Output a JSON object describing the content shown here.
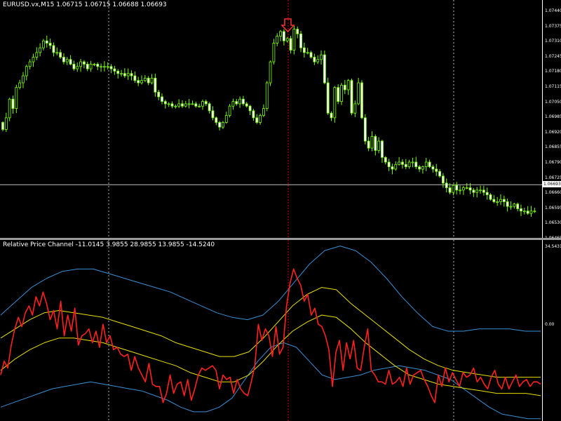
{
  "main_chart": {
    "title": "EURUSD.vx,M15  1.06715 1.06715 1.06688 1.06693",
    "price_ticks": [
      "1.07440",
      "1.07375",
      "1.07310",
      "1.07245",
      "1.07180",
      "1.07115",
      "1.07050",
      "1.06985",
      "1.06920",
      "1.06855",
      "1.06790",
      "1.06725",
      "1.06660",
      "1.06595",
      "1.06530",
      "1.06465"
    ],
    "current_price": "1.06693",
    "arrow_icon": "down-arrow-icon",
    "colors": {
      "background": "#000000",
      "candle": "#7CFC00",
      "bear_body": "#FFFFFF",
      "grid": "#FFFFFF",
      "signal_line": "#FF0000",
      "arrow": "#FF3030",
      "price_line": "#C0C0C0"
    }
  },
  "indicator": {
    "title": "Relative Price Channel -11.0145 3.9855 28.9855 13.9855 -14.5240",
    "ticks": [
      "34.5431",
      "0.00"
    ],
    "colors": {
      "outer_band": "#3A8FD4",
      "inner_band": "#E8E000",
      "value_line": "#FF2020"
    }
  },
  "chart_data": [
    {
      "type": "candlestick",
      "title": "EURUSD.vx,M15",
      "ylim": [
        1.0645,
        1.0746
      ],
      "close": [
        1.0693,
        1.0698,
        1.0706,
        1.0702,
        1.0711,
        1.0713,
        1.0716,
        1.072,
        1.0722,
        1.0724,
        1.0726,
        1.0728,
        1.0731,
        1.073,
        1.0729,
        1.0726,
        1.0726,
        1.0724,
        1.0722,
        1.0723,
        1.0721,
        1.0719,
        1.072,
        1.0722,
        1.0721,
        1.0719,
        1.0721,
        1.0721,
        1.072,
        1.072,
        1.072,
        1.072,
        1.0719,
        1.0718,
        1.0717,
        1.0717,
        1.0716,
        1.0717,
        1.0716,
        1.0714,
        1.0713,
        1.0714,
        1.0715,
        1.0713,
        1.0715,
        1.0709,
        1.0707,
        1.0705,
        1.0704,
        1.0704,
        1.0703,
        1.0703,
        1.0704,
        1.0703,
        1.0704,
        1.0704,
        1.0704,
        1.0703,
        1.0703,
        1.0705,
        1.0704,
        1.0701,
        1.0698,
        1.0696,
        1.0694,
        1.0696,
        1.0699,
        1.0703,
        1.0705,
        1.0704,
        1.0706,
        1.0704,
        1.0703,
        1.0701,
        1.0698,
        1.0696,
        1.0699,
        1.0702,
        1.0713,
        1.0722,
        1.073,
        1.0733,
        1.0735,
        1.0731,
        1.0732,
        1.0727,
        1.0736,
        1.0734,
        1.0728,
        1.0726,
        1.0726,
        1.0724,
        1.0722,
        1.0723,
        1.0725,
        1.0713,
        1.07,
        1.0698,
        1.0711,
        1.0705,
        1.0712,
        1.071,
        1.0714,
        1.07,
        1.0704,
        1.0713,
        1.0698,
        1.0688,
        1.0685,
        1.069,
        1.0684,
        1.0688,
        1.0681,
        1.0679,
        1.0677,
        1.0676,
        1.0678,
        1.0679,
        1.0678,
        1.0677,
        1.0679,
        1.0679,
        1.0677,
        1.0676,
        1.0677,
        1.0679,
        1.0677,
        1.0676,
        1.0675,
        1.0673,
        1.067,
        1.0668,
        1.0666,
        1.0669,
        1.0667,
        1.0667,
        1.0668,
        1.0668,
        1.0667,
        1.0666,
        1.0667,
        1.0667,
        1.0666,
        1.0665,
        1.0663,
        1.0662,
        1.0662,
        1.0663,
        1.0662,
        1.066,
        1.066,
        1.0661,
        1.0659,
        1.0658,
        1.0658,
        1.0657,
        1.0658,
        1.0658
      ]
    },
    {
      "type": "line",
      "title": "Relative Price Channel",
      "ylim": [
        -42,
        36
      ],
      "series": [
        {
          "name": "",
          "values": [
            -22,
            -16,
            -19,
            -9,
            -2,
            3,
            -1,
            5,
            8,
            4,
            12,
            8,
            14,
            9,
            2,
            6,
            -2,
            10,
            -5,
            4,
            -3,
            7,
            -9,
            -5,
            -4,
            -2,
            -8,
            -3,
            -10,
            0,
            -8,
            -5,
            -11,
            -10,
            -13,
            -14,
            -13,
            -20,
            -14,
            -19,
            -22,
            -25,
            -17,
            -26,
            -27,
            -27,
            -34,
            -30,
            -22,
            -30,
            -26,
            -25,
            -31,
            -24,
            -33,
            -28,
            -22,
            -19,
            -20,
            -19,
            -18,
            -20,
            -28,
            -22,
            -24,
            -23,
            -30,
            -24,
            -28,
            -30,
            -31,
            -25,
            -18,
            0,
            -7,
            -2,
            -5,
            -14,
            -1,
            -13,
            -10,
            8,
            18,
            24,
            20,
            17,
            10,
            13,
            4,
            7,
            0,
            -1,
            -5,
            -11,
            -27,
            -12,
            -7,
            -20,
            -8,
            -15,
            -7,
            -19,
            -20,
            -10,
            -2,
            -20,
            -22,
            -25,
            -25,
            -26,
            -20,
            -26,
            -25,
            -23,
            -27,
            -19,
            -26,
            -22,
            -21,
            -20,
            -24,
            -27,
            -31,
            -34,
            -22,
            -27,
            -19,
            -25,
            -21,
            -24,
            -27,
            -21,
            -23,
            -22,
            -19,
            -25,
            -23,
            -26,
            -28,
            -23,
            -20,
            -26,
            -28,
            -23,
            -28,
            -25,
            -22,
            -27,
            -25,
            -24,
            -27,
            -25,
            -25,
            -26
          ]
        },
        {
          "name": "",
          "values": [
            -36,
            -34,
            -32,
            -30,
            -28,
            -27,
            -26,
            -25,
            -26,
            -27,
            -28,
            -29,
            -31,
            -33,
            -36,
            -38,
            -38,
            -36,
            -32,
            -24,
            -16,
            -10,
            -8,
            -10,
            -16,
            -22,
            -24,
            -23,
            -22,
            -20,
            -19,
            -18,
            -19,
            -20,
            -22,
            -24,
            -28,
            -32,
            -36,
            -39,
            -40,
            -41,
            -41
          ]
        },
        {
          "name": "",
          "values": [
            -20,
            -15,
            -11,
            -8,
            -6,
            -6,
            -7,
            -8,
            -10,
            -12,
            -14,
            -16,
            -18,
            -21,
            -23,
            -25,
            -25,
            -22,
            -16,
            -9,
            -3,
            1,
            4,
            3,
            -2,
            -8,
            -13,
            -18,
            -22,
            -24,
            -26,
            -27,
            -28,
            -29,
            -30,
            -30,
            -30,
            -31
          ]
        },
        {
          "name": "",
          "values": [
            -6,
            -2,
            2,
            5,
            6,
            5,
            4,
            3,
            1,
            -1,
            -3,
            -5,
            -8,
            -10,
            -12,
            -14,
            -14,
            -12,
            -6,
            1,
            8,
            13,
            16,
            15,
            9,
            4,
            -1,
            -6,
            -11,
            -15,
            -18,
            -20,
            -21,
            -22,
            -23,
            -23,
            -23,
            -23
          ]
        },
        {
          "name": "",
          "values": [
            4,
            10,
            16,
            20,
            23,
            24,
            24,
            22,
            20,
            18,
            16,
            14,
            11,
            8,
            5,
            3,
            2,
            4,
            10,
            18,
            26,
            32,
            34,
            32,
            27,
            20,
            12,
            5,
            -1,
            -3,
            -3,
            -2,
            -2,
            -2,
            -3,
            -3
          ]
        }
      ]
    }
  ]
}
